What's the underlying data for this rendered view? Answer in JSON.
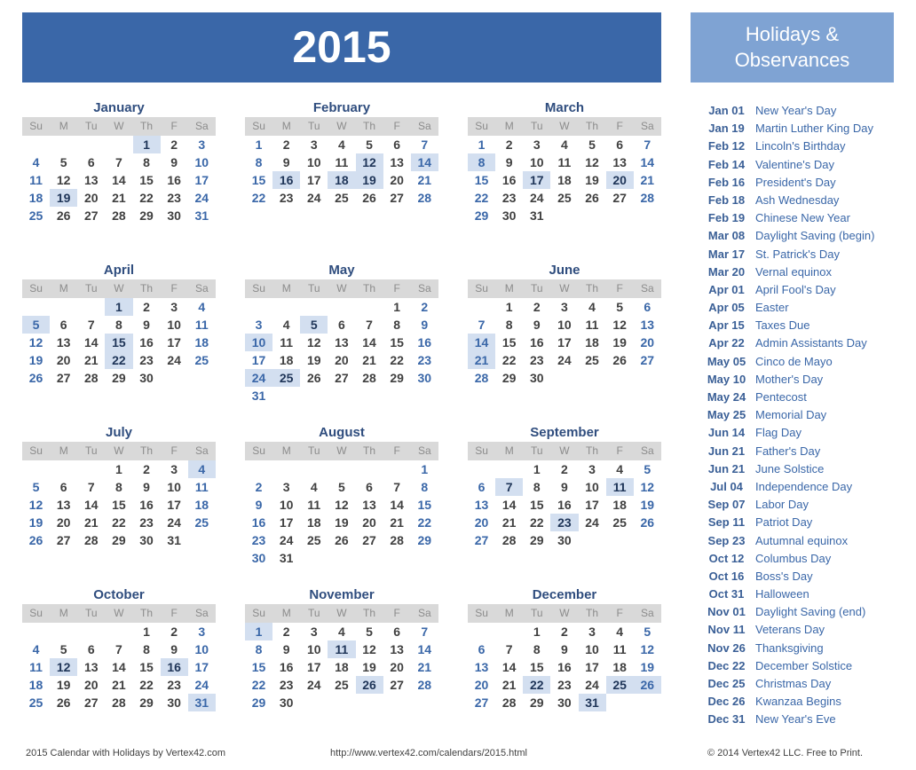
{
  "title": "2015",
  "sidebar": {
    "title_line1": "Holidays &",
    "title_line2": "Observances"
  },
  "weekdays": [
    "Su",
    "M",
    "Tu",
    "W",
    "Th",
    "F",
    "Sa"
  ],
  "months": [
    {
      "name": "January",
      "start": 4,
      "days": 31,
      "highlight": [
        1,
        19
      ]
    },
    {
      "name": "February",
      "start": 0,
      "days": 28,
      "highlight": [
        12,
        14,
        16,
        18,
        19
      ]
    },
    {
      "name": "March",
      "start": 0,
      "days": 31,
      "highlight": [
        8,
        17,
        20
      ]
    },
    {
      "name": "April",
      "start": 3,
      "days": 30,
      "highlight": [
        1,
        5,
        15,
        22
      ]
    },
    {
      "name": "May",
      "start": 5,
      "days": 31,
      "highlight": [
        5,
        10,
        24,
        25
      ]
    },
    {
      "name": "June",
      "start": 1,
      "days": 30,
      "highlight": [
        14,
        21
      ]
    },
    {
      "name": "July",
      "start": 3,
      "days": 31,
      "highlight": [
        4
      ]
    },
    {
      "name": "August",
      "start": 6,
      "days": 31,
      "highlight": []
    },
    {
      "name": "September",
      "start": 2,
      "days": 30,
      "highlight": [
        7,
        11,
        23
      ]
    },
    {
      "name": "October",
      "start": 4,
      "days": 31,
      "highlight": [
        12,
        16,
        31
      ]
    },
    {
      "name": "November",
      "start": 0,
      "days": 30,
      "highlight": [
        1,
        11,
        26
      ]
    },
    {
      "name": "December",
      "start": 2,
      "days": 31,
      "highlight": [
        22,
        25,
        26,
        31
      ]
    }
  ],
  "holidays": [
    {
      "date": "Jan 01",
      "name": "New Year's Day"
    },
    {
      "date": "Jan 19",
      "name": "Martin Luther King Day"
    },
    {
      "date": "Feb 12",
      "name": "Lincoln's Birthday"
    },
    {
      "date": "Feb 14",
      "name": "Valentine's Day"
    },
    {
      "date": "Feb 16",
      "name": "President's Day"
    },
    {
      "date": "Feb 18",
      "name": "Ash Wednesday"
    },
    {
      "date": "Feb 19",
      "name": "Chinese New Year"
    },
    {
      "date": "Mar 08",
      "name": "Daylight Saving (begin)"
    },
    {
      "date": "Mar 17",
      "name": "St. Patrick's Day"
    },
    {
      "date": "Mar 20",
      "name": "Vernal equinox"
    },
    {
      "date": "Apr 01",
      "name": "April Fool's Day"
    },
    {
      "date": "Apr 05",
      "name": "Easter"
    },
    {
      "date": "Apr 15",
      "name": "Taxes Due"
    },
    {
      "date": "Apr 22",
      "name": "Admin Assistants Day"
    },
    {
      "date": "May 05",
      "name": "Cinco de Mayo"
    },
    {
      "date": "May 10",
      "name": "Mother's Day"
    },
    {
      "date": "May 24",
      "name": "Pentecost"
    },
    {
      "date": "May 25",
      "name": "Memorial Day"
    },
    {
      "date": "Jun 14",
      "name": "Flag Day"
    },
    {
      "date": "Jun 21",
      "name": "Father's Day"
    },
    {
      "date": "Jun 21",
      "name": "June Solstice"
    },
    {
      "date": "Jul 04",
      "name": "Independence Day"
    },
    {
      "date": "Sep 07",
      "name": "Labor Day"
    },
    {
      "date": "Sep 11",
      "name": "Patriot Day"
    },
    {
      "date": "Sep 23",
      "name": "Autumnal equinox"
    },
    {
      "date": "Oct 12",
      "name": "Columbus Day"
    },
    {
      "date": "Oct 16",
      "name": "Boss's Day"
    },
    {
      "date": "Oct 31",
      "name": "Halloween"
    },
    {
      "date": "Nov 01",
      "name": "Daylight Saving (end)"
    },
    {
      "date": "Nov 11",
      "name": "Veterans Day"
    },
    {
      "date": "Nov 26",
      "name": "Thanksgiving"
    },
    {
      "date": "Dec 22",
      "name": "December Solstice"
    },
    {
      "date": "Dec 25",
      "name": "Christmas Day"
    },
    {
      "date": "Dec 26",
      "name": "Kwanzaa Begins"
    },
    {
      "date": "Dec 31",
      "name": "New Year's Eve"
    }
  ],
  "footer": {
    "left": "2015 Calendar with Holidays by Vertex42.com",
    "center": "http://www.vertex42.com/calendars/2015.html",
    "right": "© 2014 Vertex42 LLC. Free to Print."
  }
}
